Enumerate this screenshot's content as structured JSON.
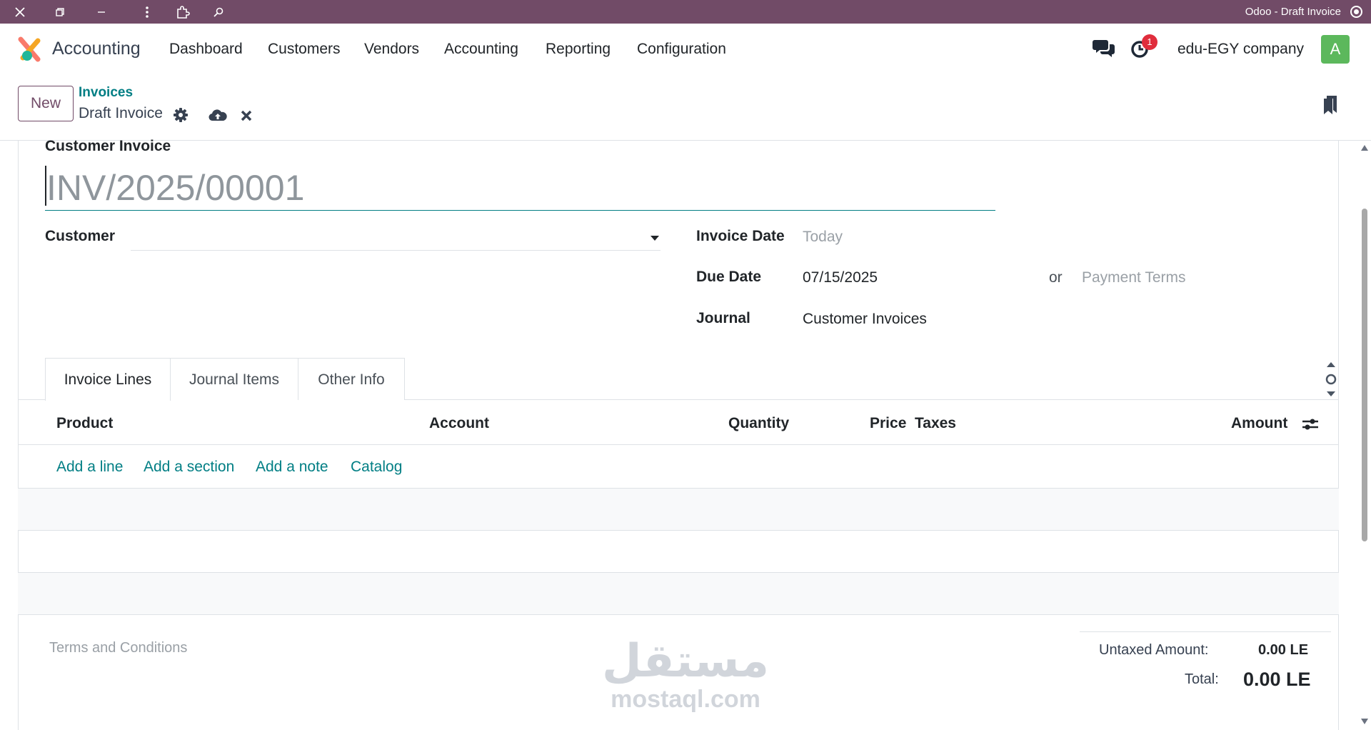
{
  "window": {
    "title": "Odoo - Draft Invoice",
    "icons": [
      "close-icon",
      "restore-icon",
      "minimize-icon",
      "more-icon",
      "extension-icon",
      "zoom-icon",
      "record-icon"
    ]
  },
  "navbar": {
    "app_name": "Accounting",
    "menu": [
      "Dashboard",
      "Customers",
      "Vendors",
      "Accounting",
      "Reporting",
      "Configuration"
    ],
    "activity_count": "1",
    "company": "edu-EGY company",
    "avatar_letter": "A"
  },
  "control": {
    "new_label": "New",
    "breadcrumb_parent": "Invoices",
    "breadcrumb_current": "Draft Invoice"
  },
  "form": {
    "section_title": "Customer Invoice",
    "invoice_number_placeholder": "INV/2025/00001",
    "customer_label": "Customer",
    "customer_value": "",
    "invoice_date_label": "Invoice Date",
    "invoice_date_placeholder": "Today",
    "due_date_label": "Due Date",
    "due_date_value": "07/15/2025",
    "or_label": "or",
    "payment_terms_placeholder": "Payment Terms",
    "journal_label": "Journal",
    "journal_value": "Customer Invoices"
  },
  "tabs": [
    "Invoice Lines",
    "Journal Items",
    "Other Info"
  ],
  "active_tab": "Invoice Lines",
  "table": {
    "columns": [
      "Product",
      "Account",
      "Quantity",
      "Price",
      "Taxes",
      "Amount"
    ],
    "add_links": [
      "Add a line",
      "Add a section",
      "Add a note",
      "Catalog"
    ]
  },
  "footer": {
    "terms_placeholder": "Terms and Conditions",
    "untaxed_label": "Untaxed Amount:",
    "untaxed_value": "0.00 LE",
    "total_label": "Total:",
    "total_value": "0.00 LE"
  },
  "watermark": {
    "arabic": "مستقل",
    "latin": "mostaql.com"
  },
  "colors": {
    "brand": "#714b67",
    "link": "#017e84",
    "badge": "#e02d3c",
    "avatar": "#5cb85c"
  }
}
